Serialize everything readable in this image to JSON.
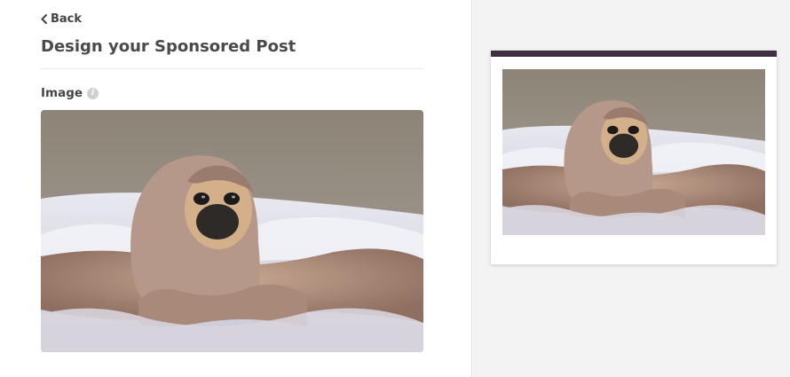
{
  "header": {
    "back_label": "Back",
    "title": "Design your Sponsored Post"
  },
  "form": {
    "image_label": "Image",
    "info_icon": "info-icon",
    "image_description_icon": "pug-photo"
  },
  "preview": {
    "accent_color": "#3f2f40"
  },
  "colors": {
    "background_right": "#f3f3f3",
    "text_dark": "#4a4a4a"
  }
}
